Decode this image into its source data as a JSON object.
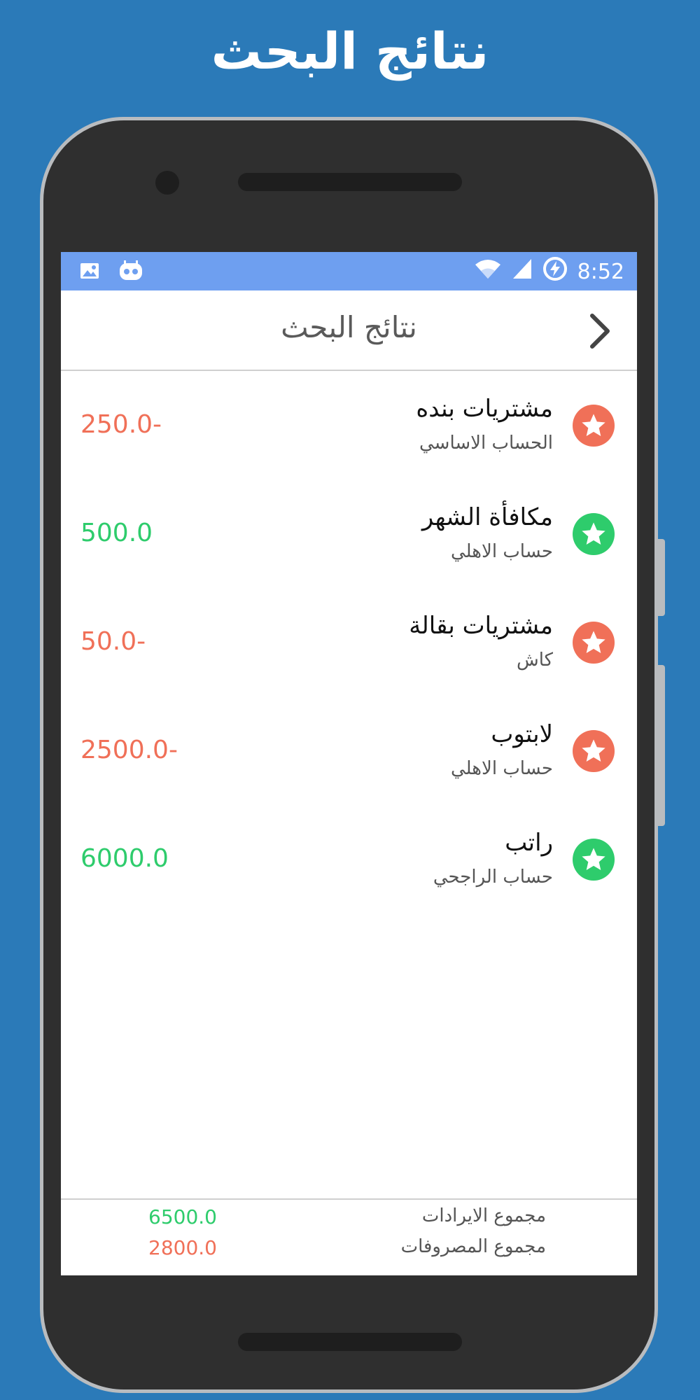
{
  "promo": {
    "title": "نتائج البحث"
  },
  "status_bar": {
    "time": "8:52"
  },
  "appbar": {
    "title": "نتائج البحث"
  },
  "colors": {
    "expense": "#f07058",
    "income": "#2ecc6c",
    "status_bar": "#6e9ff0",
    "background": "#2b7ab8"
  },
  "results": [
    {
      "title": "مشتريات بنده",
      "account": "الحساب الاساسي",
      "amount": "250.0-",
      "type": "expense",
      "icon": "star-icon"
    },
    {
      "title": "مكافأة الشهر",
      "account": "حساب الاهلي",
      "amount": "500.0",
      "type": "income",
      "icon": "star-icon"
    },
    {
      "title": "مشتريات بقالة",
      "account": "كاش",
      "amount": "50.0-",
      "type": "expense",
      "icon": "star-icon"
    },
    {
      "title": "لابتوب",
      "account": "حساب الاهلي",
      "amount": "2500.0-",
      "type": "expense",
      "icon": "star-icon"
    },
    {
      "title": "راتب",
      "account": "حساب الراجحي",
      "amount": "6000.0",
      "type": "income",
      "icon": "star-icon"
    }
  ],
  "totals": {
    "income_label": "مجموع الايرادات",
    "income_value": "6500.0",
    "expense_label": "مجموع المصروفات",
    "expense_value": "2800.0"
  }
}
